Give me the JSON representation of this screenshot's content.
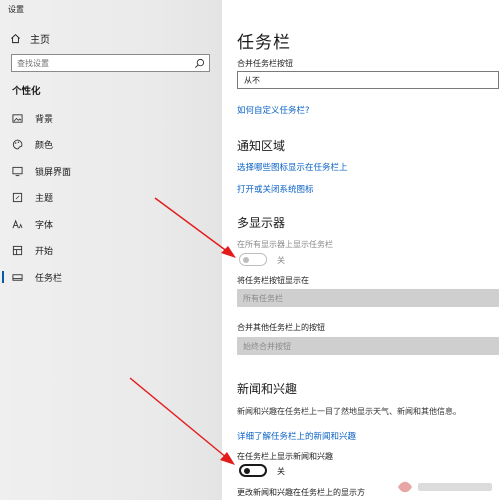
{
  "window": {
    "title": "设置"
  },
  "sidebar": {
    "home_label": "主页",
    "search_placeholder": "查找设置",
    "section_title": "个性化",
    "items": [
      {
        "label": "背景",
        "icon": "image-icon"
      },
      {
        "label": "颜色",
        "icon": "palette-icon"
      },
      {
        "label": "锁屏界面",
        "icon": "lock-screen-icon"
      },
      {
        "label": "主题",
        "icon": "theme-icon"
      },
      {
        "label": "字体",
        "icon": "font-icon"
      },
      {
        "label": "开始",
        "icon": "start-icon"
      },
      {
        "label": "任务栏",
        "icon": "taskbar-icon",
        "active": true
      }
    ]
  },
  "main": {
    "title": "任务栏",
    "combine_label": "合并任务栏按钮",
    "combine_value": "从不",
    "customize_link": "如何自定义任务栏?",
    "notification": {
      "heading": "通知区域",
      "link1": "选择哪些图标显示在任务栏上",
      "link2": "打开或关闭系统图标"
    },
    "multi_display": {
      "heading": "多显示器",
      "show_all_label": "在所有显示器上显示任务栏",
      "show_all_state": "关",
      "show_buttons_label": "将任务栏按钮显示在",
      "show_buttons_value": "所有任务栏",
      "combine_other_label": "合并其他任务栏上的按钮",
      "combine_other_value": "始终合并按钮"
    },
    "news": {
      "heading": "新闻和兴趣",
      "description": "新闻和兴趣在任务栏上一目了然地显示天气、新闻和其他信息。",
      "learn_more_link": "详细了解任务栏上的新闻和兴趣",
      "show_label": "在任务栏上显示新闻和兴趣",
      "show_state": "关",
      "change_label": "更改新闻和兴趣在任务栏上的显示方"
    }
  },
  "annotation_color": "#e31b1b",
  "accent_color": "#0a62c4"
}
